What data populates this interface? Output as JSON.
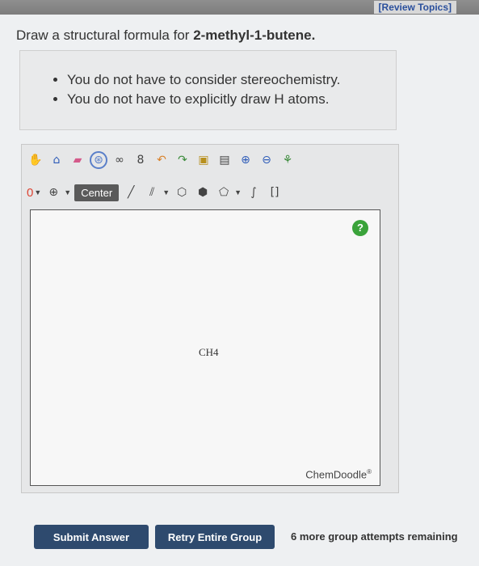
{
  "header": {
    "review_link": "[Review Topics]"
  },
  "question": {
    "prefix": "Draw a structural formula for ",
    "compound": "2-methyl-1-butene."
  },
  "notes": [
    "You do not have to consider stereochemistry.",
    "You do not have to explicitly draw H atoms."
  ],
  "editor": {
    "tooltip": "Center",
    "charge_value": "0",
    "canvas_content": "CH4",
    "help_label": "?",
    "watermark": "ChemDoodle",
    "toolbar_row1": [
      "hand-icon",
      "lasso-icon",
      "eraser-icon",
      "center-icon",
      "copy-icon",
      "number-icon",
      "undo-icon",
      "redo-icon",
      "template-icon",
      "clear-icon",
      "zoom-in-icon",
      "zoom-out-icon",
      "clean-icon"
    ],
    "toolbar_row2": [
      "charge-tool",
      "plus-charge-tool",
      "single-bond-tool",
      "double-bond-tool",
      "triple-bond-tool",
      "ring-tools",
      "bracket-tool"
    ]
  },
  "footer": {
    "submit_label": "Submit Answer",
    "retry_label": "Retry Entire Group",
    "attempts_text": "6 more group attempts remaining"
  }
}
